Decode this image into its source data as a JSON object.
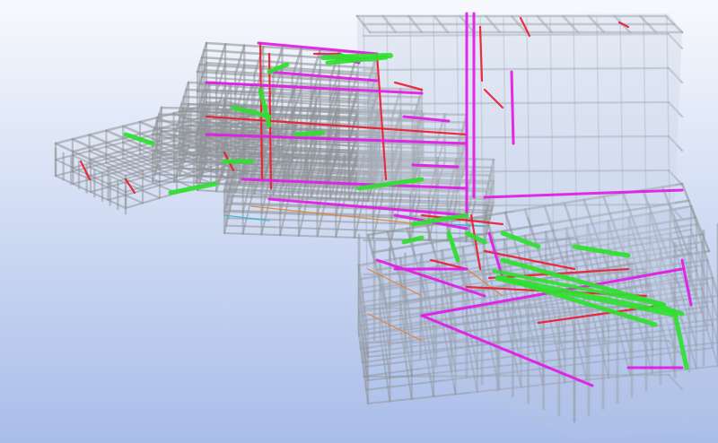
{
  "viewer": {
    "view": "3D",
    "background": {
      "top": "#f7f9fd",
      "bottom": "#a9bde9"
    },
    "layers": [
      {
        "name": "structure",
        "color": "#8f9497"
      },
      {
        "name": "duct",
        "color": "#2fe02f"
      },
      {
        "name": "pipe-magenta",
        "color": "#e21ae6"
      },
      {
        "name": "pipe-red",
        "color": "#f0182d"
      },
      {
        "name": "pipe-orange",
        "color": "#e87f2f"
      },
      {
        "name": "pipe-cyan",
        "color": "#29b7d8"
      }
    ]
  }
}
